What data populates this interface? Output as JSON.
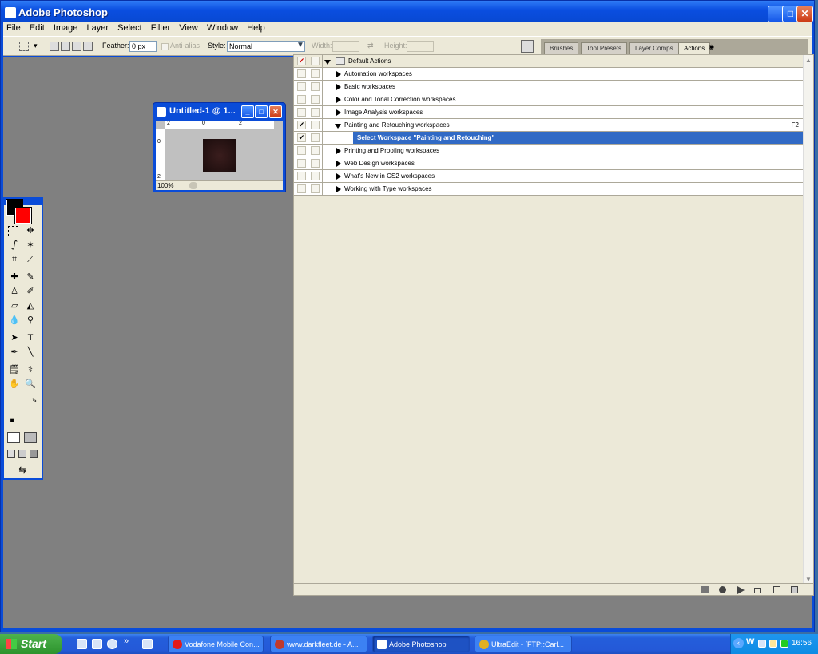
{
  "app": {
    "title": "Adobe Photoshop"
  },
  "window_controls": {
    "minimize": "_",
    "maximize": "□",
    "close": "✕"
  },
  "menu": [
    "File",
    "Edit",
    "Image",
    "Layer",
    "Select",
    "Filter",
    "View",
    "Window",
    "Help"
  ],
  "options": {
    "feather_label": "Feather:",
    "feather_value": "0 px",
    "antialias_label": "Anti-alias",
    "style_label": "Style:",
    "style_value": "Normal",
    "width_label": "Width:",
    "height_label": "Height:"
  },
  "palette_tabs": [
    "Brushes",
    "Tool Presets",
    "Layer Comps",
    "Actions"
  ],
  "actions": {
    "set_name": "Default Actions",
    "items": [
      {
        "label": "Automation workspaces",
        "checked": false
      },
      {
        "label": "Basic workspaces",
        "checked": false
      },
      {
        "label": "Color and Tonal Correction workspaces",
        "checked": false
      },
      {
        "label": "Image Analysis workspaces",
        "checked": false
      },
      {
        "label": "Painting and Retouching workspaces",
        "checked": true,
        "expanded": true,
        "shortcut": "F2"
      },
      {
        "label": "Select Workspace \"Painting and Retouching\"",
        "checked": true,
        "command": true
      },
      {
        "label": "Printing and Proofing workspaces",
        "checked": false
      },
      {
        "label": "Web Design workspaces",
        "checked": false
      },
      {
        "label": "What's New in CS2 workspaces",
        "checked": false
      },
      {
        "label": "Working with Type workspaces",
        "checked": false
      }
    ],
    "check_mark": "✔"
  },
  "document": {
    "title": "Untitled-1 @ 1...",
    "zoom": "100%",
    "ruler_h": [
      "2",
      "0",
      "2"
    ],
    "ruler_v": [
      "0",
      "2"
    ]
  },
  "tools": {
    "type_tool": "T"
  },
  "taskbar": {
    "start_label": "Start",
    "tasks": [
      {
        "label": "Vodafone Mobile Con...",
        "color": "#e21a1a"
      },
      {
        "label": "www.darkfleet.de - A...",
        "color": "#c0392b"
      },
      {
        "label": "Adobe Photoshop",
        "color": "#2a6be0"
      },
      {
        "label": "UltraEdit - [FTP::Carl...",
        "color": "#e0b020"
      }
    ],
    "chevron": "»",
    "clock": "16:56"
  }
}
